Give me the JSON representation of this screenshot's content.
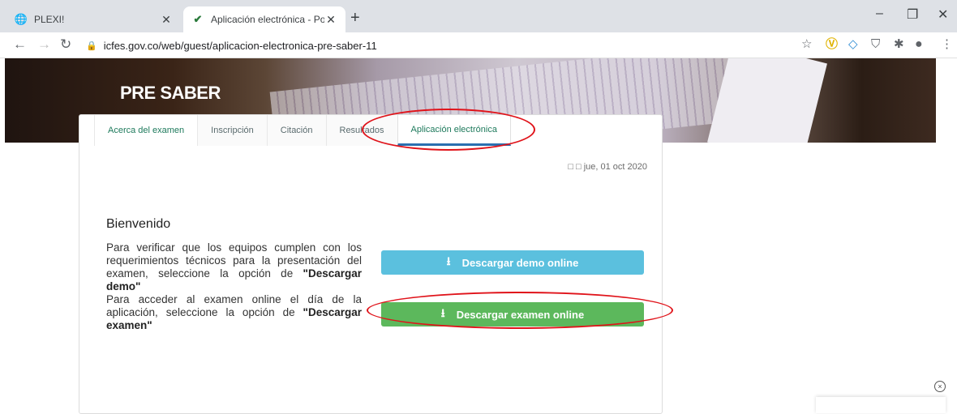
{
  "browser": {
    "tabs": [
      {
        "title": "PLEXI!",
        "icon": "globe-icon"
      },
      {
        "title": "Aplicación electrónica - Portal Icf",
        "icon": "icfes-icon"
      }
    ],
    "new_tab": "+",
    "url": "icfes.gov.co/web/guest/aplicacion-electronica-pre-saber-11",
    "window_controls": {
      "minimize": "–",
      "restore": "❐",
      "close": "✕"
    }
  },
  "hero": {
    "title": "PRE SABER"
  },
  "nav_tabs": [
    "Acerca del examen",
    "Inscripción",
    "Citación",
    "Resultados",
    "Aplicación electrónica"
  ],
  "main": {
    "date": "□ □ jue, 01 oct 2020",
    "heading": "Bienvenido",
    "para1_text": "Para verificar que los equipos cumplen con los requerimientos técnicos para la presentación del examen, seleccione la opción de ",
    "para1_bold": "\"Descargar demo\"",
    "para2_text": "Para acceder al examen online el día de la aplicación, seleccione la opción de ",
    "para2_bold": "\"Descargar examen\"",
    "demo_button": "Descargar demo online",
    "exam_button": "Descargar examen online"
  },
  "colors": {
    "demo": "#5bc0de",
    "exam": "#5cb85c",
    "annotation": "#e0131a",
    "tab_active_border": "#2a6fb0"
  },
  "corner_close": "×"
}
